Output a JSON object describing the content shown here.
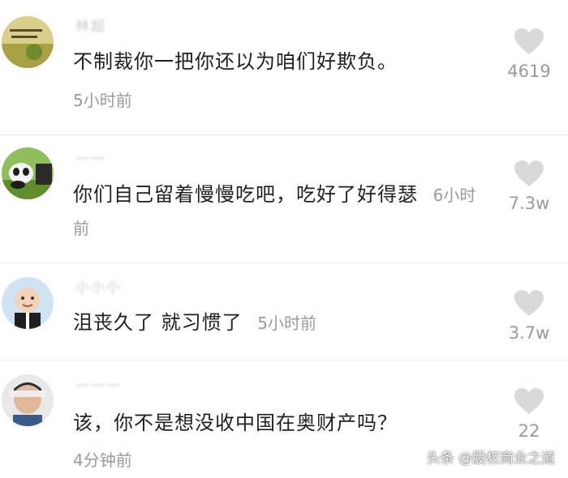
{
  "comments": [
    {
      "username": "林超",
      "text": "不制裁你一把你还以为咱们好欺负。",
      "time": "5小时前",
      "likes": "4619"
    },
    {
      "username": "一一",
      "text": "你们自己留着慢慢吃吧，吃好了好得瑟",
      "time": "6小时前",
      "likes": "7.3w"
    },
    {
      "username": "小小小",
      "text": "沮丧久了 就习惯了",
      "time": "5小时前",
      "likes": "3.7w"
    },
    {
      "username": "一一一",
      "text": "该，你不是想没收中国在奥财产吗？",
      "time": "4分钟前",
      "likes": "22"
    }
  ],
  "watermark": "头条 @股权商业之道",
  "colors": {
    "heart": "#d9d9d9",
    "meta": "#9a9a9a",
    "text": "#1f1f1f"
  }
}
